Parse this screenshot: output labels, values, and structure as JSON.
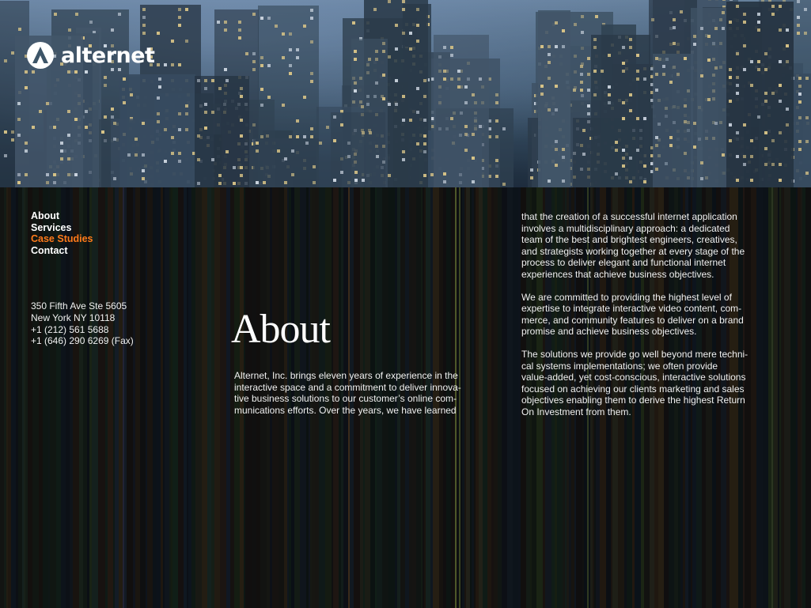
{
  "brand": {
    "name": "alternet"
  },
  "nav": {
    "items": [
      {
        "label": "About",
        "active": false
      },
      {
        "label": "Services",
        "active": false
      },
      {
        "label": "Case Studies",
        "active": true
      },
      {
        "label": "Contact",
        "active": false
      }
    ]
  },
  "address": {
    "street": "350 Fifth Ave Ste 5605",
    "city": "New York NY 10118",
    "phone": "+1 (212) 561 5688",
    "fax": "+1 (646) 290 6269 (Fax)"
  },
  "page": {
    "title": "About",
    "col1_lines": [
      "Alternet, Inc. brings eleven years of experience in the",
      "interactive space and a commitment to deliver innova-",
      "tive business solutions to our customer’s online com-",
      "munications efforts. Over the years, we have learned"
    ],
    "col2_p1_lines": [
      "that the creation of a successful internet application",
      "involves a multidisciplinary approach: a dedicated",
      "team of the best and brightest engineers, creatives,",
      "and strategists working together at every stage of the",
      "process to deliver elegant and functional internet",
      "experiences that achieve business objectives."
    ],
    "col2_p2_lines": [
      "We are committed to providing the highest level of",
      "expertise to integrate interactive video content, com-",
      "merce, and community features to deliver on a brand",
      "promise and achieve business objectives."
    ],
    "col2_p3_lines": [
      "The solutions we provide go well beyond mere techni-",
      "cal systems implementations; we often provide",
      "value-added, yet cost-conscious, interactive solutions",
      "focused on achieving our clients marketing and sales",
      "objectives enabling them to derive the highest Return",
      "On Investment from them."
    ]
  },
  "colors": {
    "accent": "#ff7a1a",
    "text": "#f2f2f2",
    "background": "#0b0f14"
  },
  "icons": {
    "logo": "alternet-a-logo-icon"
  }
}
